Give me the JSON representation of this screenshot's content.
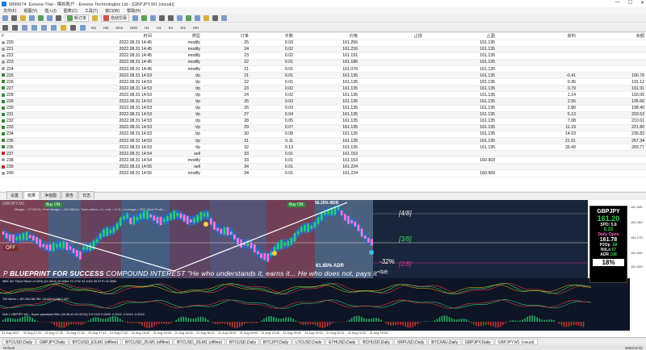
{
  "window": {
    "title": "5899074: Exness-Trial - 模拟账户 - Exness Technologies Ltd - [GBPJPY,M1 (visual)]"
  },
  "menu": [
    "文件(F)",
    "视图(V)",
    "插入(I)",
    "图表(C)",
    "工具(T)",
    "窗口(W)",
    "帮助(H)"
  ],
  "toolbar": {
    "new_order": "新订单",
    "auto_trade": "自动交易"
  },
  "timeframes": [
    "M1",
    "M5",
    "M15",
    "M30",
    "H1",
    "H4",
    "D1",
    "W1",
    "MN"
  ],
  "table": {
    "columns": [
      "#",
      "时间",
      "类型",
      "订单",
      "手数",
      "价格",
      "止损",
      "止盈",
      "获利",
      "余额"
    ],
    "rows": [
      {
        "id": "220",
        "time": "2022.08.31 14:45",
        "type": "modify",
        "order": "25",
        "lots": "0.03",
        "price": "161.256",
        "sl": "",
        "tp": "161.135",
        "profit": "",
        "balance": "",
        "kind": "mod"
      },
      {
        "id": "221",
        "time": "2022.08.31 14:45",
        "type": "modify",
        "order": "24",
        "lots": "0.02",
        "price": "161.216",
        "sl": "",
        "tp": "161.135",
        "profit": "",
        "balance": "",
        "kind": "mod"
      },
      {
        "id": "222",
        "time": "2022.08.31 14:45",
        "type": "modify",
        "order": "23",
        "lots": "0.02",
        "price": "161.191",
        "sl": "",
        "tp": "161.135",
        "profit": "",
        "balance": "",
        "kind": "mod"
      },
      {
        "id": "223",
        "time": "2022.08.31 14:45",
        "type": "modify",
        "order": "22",
        "lots": "0.01",
        "price": "161.186",
        "sl": "",
        "tp": "161.135",
        "profit": "",
        "balance": "",
        "kind": "mod"
      },
      {
        "id": "224",
        "time": "2022.08.31 14:45",
        "type": "modify",
        "order": "21",
        "lots": "0.01",
        "price": "161.076",
        "sl": "",
        "tp": "161.135",
        "profit": "",
        "balance": "",
        "kind": "mod"
      },
      {
        "id": "225",
        "time": "2022.08.31 14:53",
        "type": "t/p",
        "order": "21",
        "lots": "0.01",
        "price": "161.135",
        "sl": "",
        "tp": "161.135",
        "profit": "-0.41",
        "balance": "190.76",
        "kind": "buy"
      },
      {
        "id": "226",
        "time": "2022.08.31 14:53",
        "type": "t/p",
        "order": "22",
        "lots": "0.01",
        "price": "161.135",
        "sl": "",
        "tp": "161.135",
        "profit": "0.36",
        "balance": "191.12",
        "kind": "buy"
      },
      {
        "id": "227",
        "time": "2022.08.31 14:53",
        "type": "t/p",
        "order": "23",
        "lots": "0.02",
        "price": "161.135",
        "sl": "",
        "tp": "161.135",
        "profit": "0.79",
        "balance": "191.91",
        "kind": "buy"
      },
      {
        "id": "228",
        "time": "2022.08.31 14:53",
        "type": "t/p",
        "order": "24",
        "lots": "0.02",
        "price": "161.135",
        "sl": "",
        "tp": "161.135",
        "profit": "1.14",
        "balance": "193.05",
        "kind": "buy"
      },
      {
        "id": "229",
        "time": "2022.08.31 14:53",
        "type": "t/p",
        "order": "25",
        "lots": "0.03",
        "price": "161.135",
        "sl": "",
        "tp": "161.135",
        "profit": "2.55",
        "balance": "195.60",
        "kind": "buy"
      },
      {
        "id": "230",
        "time": "2022.08.31 14:53",
        "type": "t/p",
        "order": "26",
        "lots": "0.03",
        "price": "161.135",
        "sl": "",
        "tp": "161.135",
        "profit": "2.80",
        "balance": "198.40",
        "kind": "buy"
      },
      {
        "id": "231",
        "time": "2022.08.31 14:53",
        "type": "t/p",
        "order": "27",
        "lots": "0.04",
        "price": "161.135",
        "sl": "",
        "tp": "161.135",
        "profit": "5.13",
        "balance": "203.53",
        "kind": "buy"
      },
      {
        "id": "232",
        "time": "2022.08.31 14:53",
        "type": "t/p",
        "order": "28",
        "lots": "0.05",
        "price": "161.135",
        "sl": "",
        "tp": "161.135",
        "profit": "7.08",
        "balance": "210.61",
        "kind": "buy"
      },
      {
        "id": "233",
        "time": "2022.08.31 14:53",
        "type": "t/p",
        "order": "29",
        "lots": "0.07",
        "price": "161.135",
        "sl": "",
        "tp": "161.135",
        "profit": "11.19",
        "balance": "221.80",
        "kind": "buy"
      },
      {
        "id": "234",
        "time": "2022.08.31 14:53",
        "type": "t/p",
        "order": "30",
        "lots": "0.08",
        "price": "161.135",
        "sl": "",
        "tp": "161.135",
        "profit": "14.03",
        "balance": "235.83",
        "kind": "buy"
      },
      {
        "id": "235",
        "time": "2022.08.31 14:53",
        "type": "t/p",
        "order": "31",
        "lots": "0.11",
        "price": "161.135",
        "sl": "",
        "tp": "161.135",
        "profit": "21.51",
        "balance": "257.34",
        "kind": "buy"
      },
      {
        "id": "236",
        "time": "2022.08.31 14:53",
        "type": "t/p",
        "order": "32",
        "lots": "0.13",
        "price": "161.135",
        "sl": "",
        "tp": "161.135",
        "profit": "26.43",
        "balance": "283.77",
        "kind": "buy"
      },
      {
        "id": "237",
        "time": "2022.08.31 14:54",
        "type": "sell",
        "order": "33",
        "lots": "0.01",
        "price": "161.153",
        "sl": "",
        "tp": "",
        "profit": "",
        "balance": "",
        "kind": "sell"
      },
      {
        "id": "238",
        "time": "2022.08.31 14:54",
        "type": "modify",
        "order": "33",
        "lots": "0.01",
        "price": "161.153",
        "sl": "",
        "tp": "160.903",
        "profit": "",
        "balance": "",
        "kind": "mod"
      },
      {
        "id": "239",
        "time": "2022.08.31 14:55",
        "type": "sell",
        "order": "34",
        "lots": "0.01",
        "price": "161.224",
        "sl": "",
        "tp": "",
        "profit": "",
        "balance": "",
        "kind": "sell"
      },
      {
        "id": "240",
        "time": "2022.08.31 14:55",
        "type": "modify",
        "order": "34",
        "lots": "0.01",
        "price": "161.224",
        "sl": "",
        "tp": "160.969",
        "profit": "",
        "balance": "",
        "kind": "mod"
      }
    ]
  },
  "subtabs": [
    "设置",
    "结果",
    "净值图",
    "报告",
    "日志"
  ],
  "chart": {
    "symbol_header": "GBPJPY,M1",
    "margin_line": "Margin = 27.812%, Free Margin = 225.68434, Total orders = 6, Lots = 0.01, Leverage = 500, Total Profit = -",
    "buy_on_label": "Buy ON",
    "buy_on_label2": "Buy ON",
    "off_label": "OFF",
    "pct_label": "56.25% BDR",
    "adr_label": "61.85% ADR",
    "level_top": "[4/8]",
    "level_mid": "[3/8]",
    "level_low": "[2/8]",
    "level_neg": "-32%",
    "hint_label": "冻结:",
    "banner_prefix": "P",
    "banner_strong": "BLUEPRINT FOR SUCCESS",
    "banner_rest": "COMPOUND INTEREST \"He who understands it, earns it... He who does not, pays it\"",
    "bb_label": "BB",
    "ind1_label": "MB1 M1 TDI(of Stoch of 34%) [10.3814] 50.8364 73.2732 42.1004 39.3770 42.3960",
    "ind2_label": "TDI Alerts = 167.564 66.789 -18.020 0.088 2.497",
    "ind3_label": "Sub 1 GBPJPY M1 - Super passband filter (40.08,40.00,33.00) 0.0.0112 0.0000 -0.0022 -0.0019 -0.0019",
    "price_ticks": [
      "161.345",
      "161.260",
      "161.175",
      "161.090",
      "161.005"
    ],
    "time_ticks": [
      "31 Aug 2022",
      "31 Aug 17:20",
      "31 Aug 17:28",
      "31 Aug 17:36",
      "31 Aug 17:44",
      "31 Aug 17:52",
      "31 Aug 18:00",
      "31 Aug 18:08",
      "31 Aug 18:16",
      "31 Aug 18:24",
      "31 Aug 18:32",
      "31 Aug 18:40",
      "31 Aug 18:48",
      "31 Aug 18:56",
      "31 Aug 19:04",
      "31 Aug 19:12",
      "31 Aug 19:20",
      "31 Aug 19:28"
    ]
  },
  "panel": {
    "symbol": "GBPJPY",
    "price": "161.20",
    "spd_label": "SPD",
    "spd_value": "5.8",
    "change": "0.22",
    "daily_open_label": "Daily Open",
    "daily_open": "161.78",
    "p2op_label": "P2Op",
    "p2op_value": "-58",
    "hilo_label": "Hi/Lo",
    "hilo_value": "67",
    "adr_label": "ADR",
    "adr_value": "108",
    "pct": "18%"
  },
  "bottom_tabs": [
    "BTCUSD,Daily",
    "GBPJPY,Daily",
    "BTCUSD_ES,M1 (offline)",
    "BTCUSD_25,M1 (offline)",
    "BTCUSD_3S,M1 (offline)",
    "BTCUSD,Daily",
    "BTCJPY,Daily",
    "LTCUSD,Daily",
    "ETHUSD,Daily",
    "BCHUSD,Daily",
    "XRPUSD,Daily",
    "BTCXAU,Daily",
    "GBPJPY,Daily",
    "GBPJPY,M1 (visual)"
  ],
  "status": {
    "left": "Default",
    "right": "3856/15 kb"
  },
  "colors": {
    "chart_bg": "#1b2a3a",
    "bull": "#2ecc71",
    "bear": "#c0392b",
    "band": "#1f6fd1"
  }
}
